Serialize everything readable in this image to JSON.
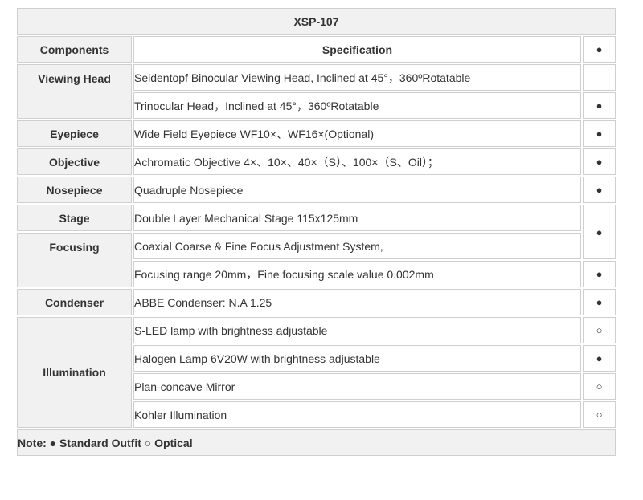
{
  "title": "XSP-107",
  "header": {
    "components": "Components",
    "specification": "Specification",
    "mark": "●"
  },
  "rows": [
    {
      "component": "Viewing Head",
      "spec": "Seidentopf Binocular Viewing Head, Inclined at 45°，360ºRotatable",
      "mark": ""
    },
    {
      "component": "",
      "spec": "Trinocular Head，Inclined at 45°，360ºRotatable",
      "mark": "●"
    },
    {
      "component": "Eyepiece",
      "spec": "Wide Field Eyepiece WF10×、WF16×(Optional)",
      "mark": "●"
    },
    {
      "component": "Objective",
      "spec": "Achromatic Objective 4×、10×、40×（S）、100×（S、Oil）；",
      "mark": "●"
    },
    {
      "component": "Nosepiece",
      "spec": "Quadruple Nosepiece",
      "mark": "●"
    },
    {
      "component": "Stage",
      "spec": "Double Layer Mechanical Stage 115x125mm",
      "mark": "●"
    },
    {
      "component": "Focusing",
      "spec": "Coaxial Coarse & Fine Focus Adjustment System,",
      "mark": ""
    },
    {
      "component": "",
      "spec": "Focusing range 20mm，Fine focusing scale value 0.002mm",
      "mark": "●"
    },
    {
      "component": "Condenser",
      "spec": "ABBE Condenser: N.A 1.25",
      "mark": "●"
    },
    {
      "component": "Illumination",
      "spec": "S-LED lamp with brightness adjustable",
      "mark": "○"
    },
    {
      "component": "",
      "spec": "Halogen Lamp 6V20W with brightness adjustable",
      "mark": "●"
    },
    {
      "component": "",
      "spec": "Plan-concave Mirror",
      "mark": "○"
    },
    {
      "component": "",
      "spec": "Kohler Illumination",
      "mark": "○"
    }
  ],
  "note": "Note:  ● Standard Outfit ○ Optical"
}
